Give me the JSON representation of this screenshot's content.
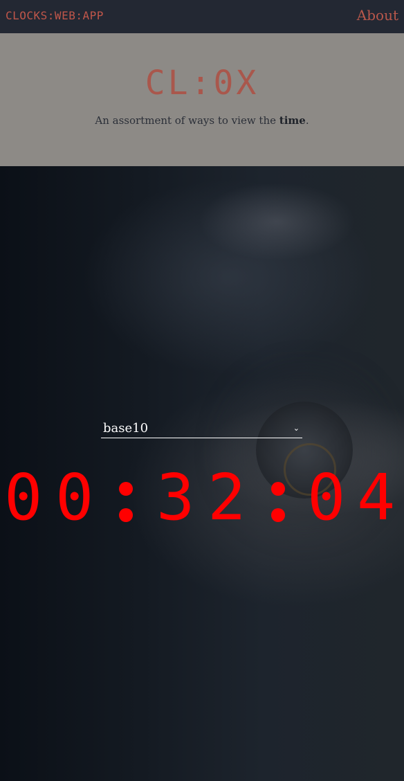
{
  "nav": {
    "brand": "CLOCKS:WEB:APP",
    "about": "About"
  },
  "hero": {
    "title": "CL:0X",
    "subtitle_before": "An assortment of ways to view the ",
    "subtitle_bold": "time",
    "subtitle_after": "."
  },
  "clock": {
    "base_select": {
      "value": "base10",
      "icon": "chevron-down-icon"
    },
    "hours": [
      "0",
      "0"
    ],
    "minutes": [
      "3",
      "2"
    ],
    "seconds": [
      "0",
      "4"
    ],
    "color": "#ff0000"
  },
  "colors": {
    "nav_bg": "#232833",
    "accent": "#c0564a",
    "hero_bg": "#8d8a86"
  }
}
